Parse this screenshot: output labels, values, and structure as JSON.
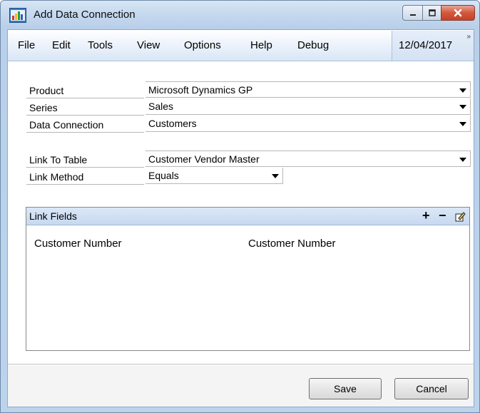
{
  "window": {
    "title": "Add Data Connection",
    "icon": "data-connection-icon",
    "controls": {
      "minimize": "minimize-icon",
      "maximize": "maximize-icon",
      "close": "close-icon"
    }
  },
  "menu": {
    "items": [
      "File",
      "Edit",
      "Tools",
      "View",
      "Options",
      "Help",
      "Debug"
    ],
    "date": "12/04/2017",
    "overflow_glyph": "»"
  },
  "form": {
    "product": {
      "label": "Product",
      "value": "Microsoft Dynamics GP"
    },
    "series": {
      "label": "Series",
      "value": "Sales"
    },
    "data_connection": {
      "label": "Data Connection",
      "value": "Customers"
    },
    "link_to_table": {
      "label": "Link To Table",
      "value": "Customer Vendor Master"
    },
    "link_method": {
      "label": "Link Method",
      "value": "Equals"
    }
  },
  "link_fields": {
    "title": "Link Fields",
    "tools": {
      "add": "+",
      "remove": "−",
      "edit": "edit-icon"
    },
    "rows": [
      {
        "left": "Customer Number",
        "right": "Customer Number"
      }
    ]
  },
  "buttons": {
    "save": "Save",
    "cancel": "Cancel"
  },
  "colors": {
    "accent": "#c4d8ee",
    "close": "#c8402a"
  }
}
